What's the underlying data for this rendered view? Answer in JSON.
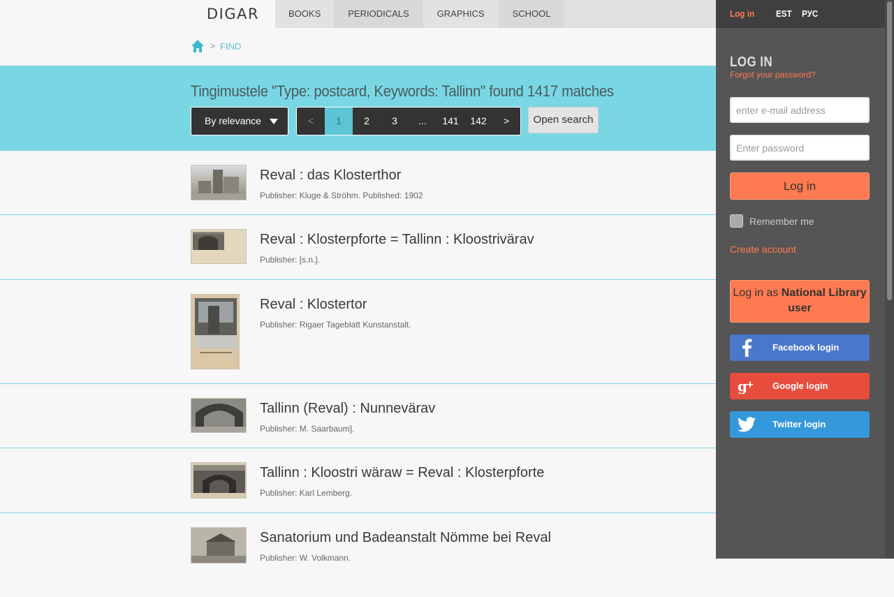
{
  "header": {
    "logo": "DIGAR",
    "nav": [
      {
        "label": "BOOKS"
      },
      {
        "label": "PERIODICALS"
      },
      {
        "label": "GRAPHICS"
      },
      {
        "label": "SCHOOL"
      }
    ]
  },
  "breadcrumb": {
    "separator": ">",
    "current": "FIND"
  },
  "search": {
    "summary": "Tingimustele \"Type: postcard, Keywords: Tallinn\" found 1417 matches",
    "sort_label": "By relevance",
    "pager": {
      "prev": "<",
      "pages": [
        "1",
        "2",
        "3",
        "...",
        "141",
        "142"
      ],
      "current": "1",
      "next": ">"
    },
    "open_search": "Open search"
  },
  "results": [
    {
      "title": "Reval : das Klosterthor",
      "meta": "Publisher: Kluge & Ströhm. Published: 1902"
    },
    {
      "title": "Reval : Klosterpforte = Tallinn : Kloostrivärav",
      "meta": "Publisher: [s.n.]."
    },
    {
      "title": "Reval : Klostertor",
      "meta": "Publisher: Rigaer Tageblatt Kunstanstalt."
    },
    {
      "title": "Tallinn (Reval) : Nunnevärav",
      "meta": "Publisher: M. Saarbaum]."
    },
    {
      "title": "Tallinn : Kloostri wäraw = Reval : Klosterpforte",
      "meta": "Publisher: Karl Lemberg."
    },
    {
      "title": "Sanatorium und Badeanstalt Nömme bei Reval",
      "meta": "Publisher: W. Volkmann."
    }
  ],
  "panel": {
    "top": {
      "login": "Log in",
      "lang_est": "EST",
      "lang_rus": "РУС"
    },
    "heading": "LOG IN",
    "forgot": "Forgot your password?",
    "email_placeholder": "enter e-mail address",
    "password_placeholder": "Enter password",
    "login_button": "Log in",
    "remember": "Remember me",
    "create_account": "Create account",
    "nl_login_prefix": "Log in as",
    "nl_login_bold": "National Library user",
    "facebook": "Facebook login",
    "google": "Google login",
    "twitter": "Twitter login"
  },
  "colors": {
    "accent_cyan": "#79d7e4",
    "accent_orange": "#ff7a50",
    "facebook": "#4a77c9",
    "google": "#e74c3c",
    "twitter": "#3498db"
  }
}
